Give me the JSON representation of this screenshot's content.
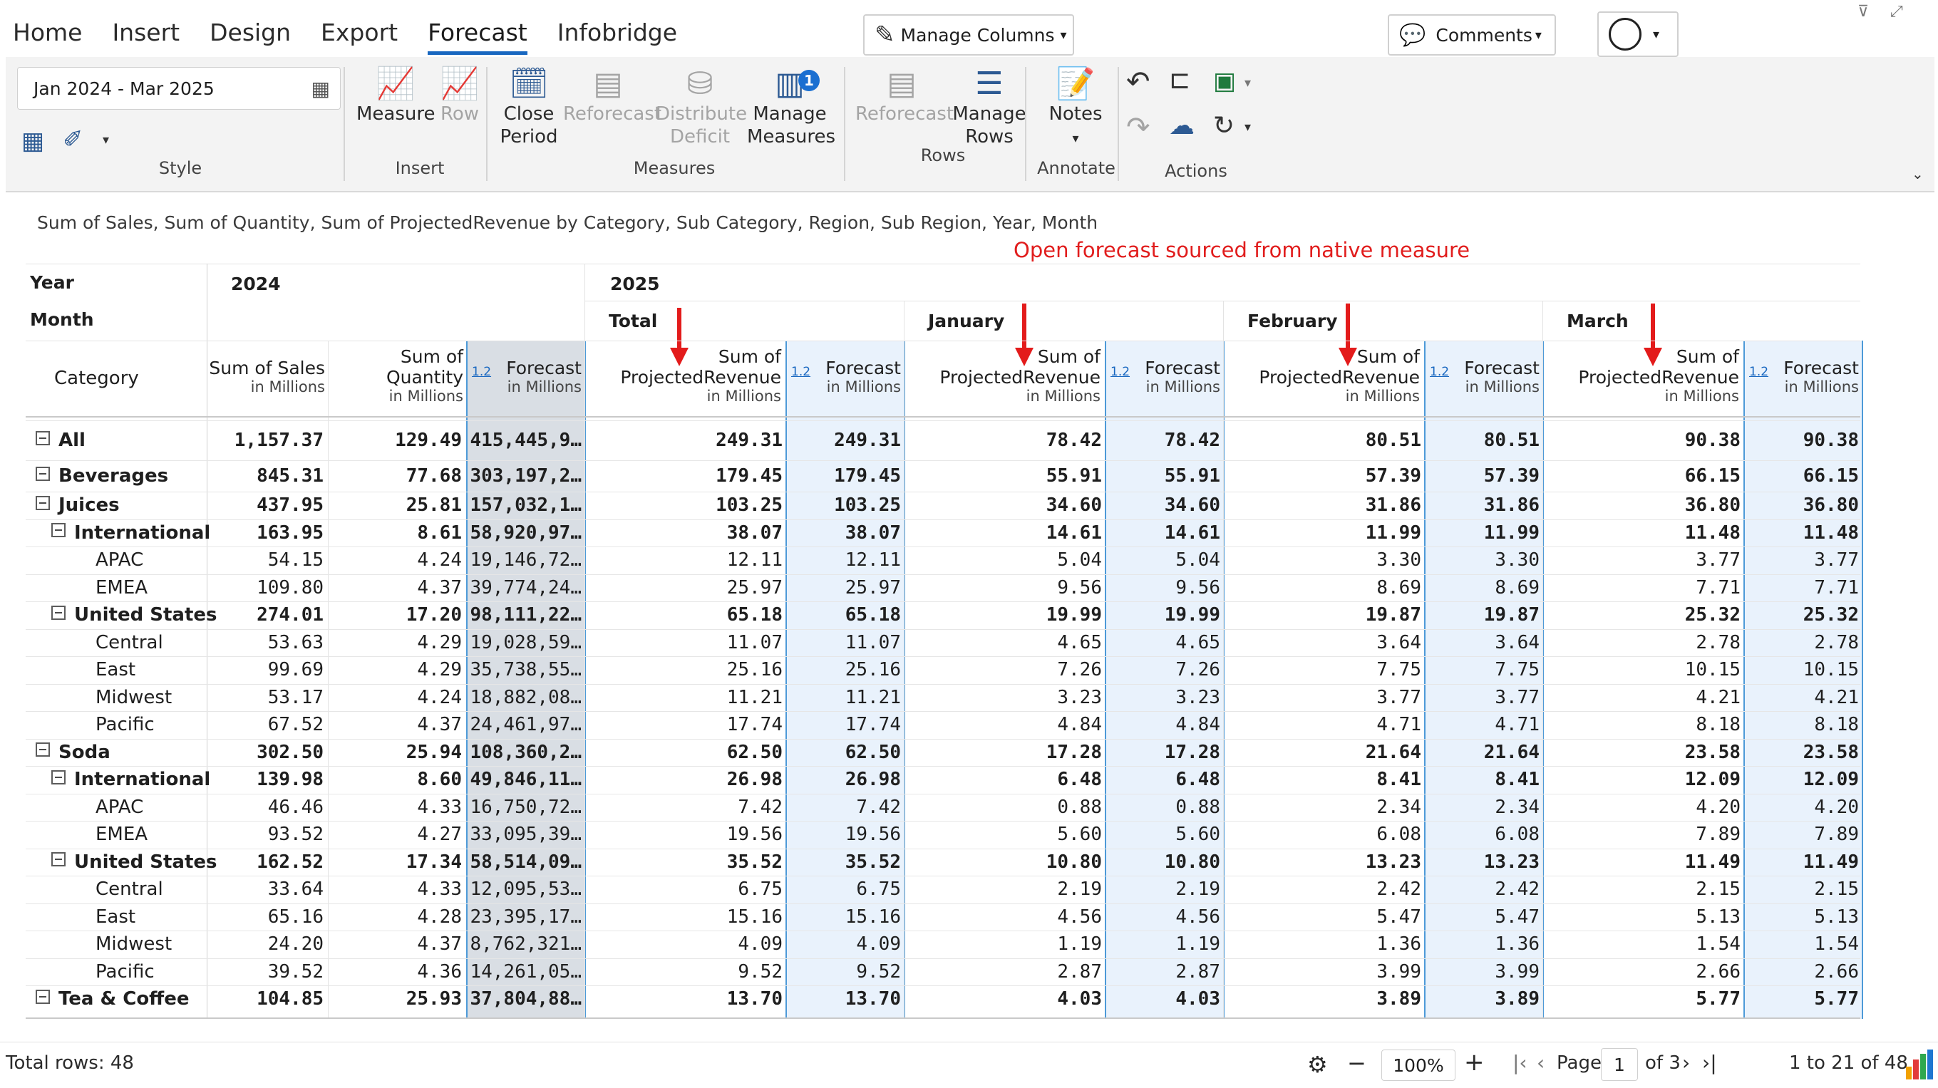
{
  "tabs": [
    {
      "label": "Home",
      "active": false
    },
    {
      "label": "Insert",
      "active": false
    },
    {
      "label": "Design",
      "active": false
    },
    {
      "label": "Export",
      "active": false
    },
    {
      "label": "Forecast",
      "active": true
    },
    {
      "label": "Infobridge",
      "active": false
    }
  ],
  "manage_columns": "Manage Columns",
  "comments": "Comments",
  "date_range": "Jan 2024 - Mar 2025",
  "ribbon": {
    "style_group": "Style",
    "insert_group": "Insert",
    "measure": "Measure",
    "row": "Row",
    "close_period_1": "Close",
    "close_period_2": "Period",
    "reforecast": "Reforecast",
    "distribute_1": "Distribute",
    "distribute_2": "Deficit",
    "manage_measures_1": "Manage",
    "manage_measures_2": "Measures",
    "manage_measures_badge": "1",
    "measures_group": "Measures",
    "reforecast_rows": "Reforecast",
    "manage_rows_1": "Manage",
    "manage_rows_2": "Rows",
    "rows_group": "Rows",
    "notes": "Notes",
    "annotate_group": "Annotate",
    "actions_group": "Actions"
  },
  "caption": "Sum of Sales, Sum of Quantity, Sum of ProjectedRevenue by Category, Sub Category, Region, Sub Region, Year, Month",
  "annotation": "Open forecast sourced from native measure",
  "headers": {
    "year": "Year",
    "month": "Month",
    "category": "Category",
    "y2024": "2024",
    "y2025": "2025",
    "total": "Total",
    "january": "January",
    "february": "February",
    "march": "March",
    "sum_sales": "Sum of Sales",
    "sum_of": "Sum of",
    "quantity": "Quantity",
    "projected": "ProjectedRevenue",
    "forecast": "Forecast",
    "in_millions": "in Millions",
    "tag": "1.2"
  },
  "rows": [
    {
      "label": "All",
      "level": 0,
      "bold": true,
      "toggle": true,
      "v": [
        "1,157.37",
        "129.49",
        "415,445,9…",
        "249.31",
        "249.31",
        "78.42",
        "78.42",
        "80.51",
        "80.51",
        "90.38",
        "90.38"
      ]
    },
    {
      "label": "Beverages",
      "level": 0,
      "bold": true,
      "toggle": true,
      "v": [
        "845.31",
        "77.68",
        "303,197,2…",
        "179.45",
        "179.45",
        "55.91",
        "55.91",
        "57.39",
        "57.39",
        "66.15",
        "66.15"
      ]
    },
    {
      "label": "Juices",
      "level": 1,
      "bold": true,
      "toggle": true,
      "v": [
        "437.95",
        "25.81",
        "157,032,1…",
        "103.25",
        "103.25",
        "34.60",
        "34.60",
        "31.86",
        "31.86",
        "36.80",
        "36.80"
      ]
    },
    {
      "label": "International",
      "level": 2,
      "bold": true,
      "toggle": true,
      "v": [
        "163.95",
        "8.61",
        "58,920,97…",
        "38.07",
        "38.07",
        "14.61",
        "14.61",
        "11.99",
        "11.99",
        "11.48",
        "11.48"
      ]
    },
    {
      "label": "APAC",
      "level": 3,
      "bold": false,
      "toggle": false,
      "v": [
        "54.15",
        "4.24",
        "19,146,72…",
        "12.11",
        "12.11",
        "5.04",
        "5.04",
        "3.30",
        "3.30",
        "3.77",
        "3.77"
      ]
    },
    {
      "label": "EMEA",
      "level": 3,
      "bold": false,
      "toggle": false,
      "v": [
        "109.80",
        "4.37",
        "39,774,24…",
        "25.97",
        "25.97",
        "9.56",
        "9.56",
        "8.69",
        "8.69",
        "7.71",
        "7.71"
      ]
    },
    {
      "label": "United States",
      "level": 2,
      "bold": true,
      "toggle": true,
      "v": [
        "274.01",
        "17.20",
        "98,111,22…",
        "65.18",
        "65.18",
        "19.99",
        "19.99",
        "19.87",
        "19.87",
        "25.32",
        "25.32"
      ]
    },
    {
      "label": "Central",
      "level": 3,
      "bold": false,
      "toggle": false,
      "v": [
        "53.63",
        "4.29",
        "19,028,59…",
        "11.07",
        "11.07",
        "4.65",
        "4.65",
        "3.64",
        "3.64",
        "2.78",
        "2.78"
      ]
    },
    {
      "label": "East",
      "level": 3,
      "bold": false,
      "toggle": false,
      "v": [
        "99.69",
        "4.29",
        "35,738,55…",
        "25.16",
        "25.16",
        "7.26",
        "7.26",
        "7.75",
        "7.75",
        "10.15",
        "10.15"
      ]
    },
    {
      "label": "Midwest",
      "level": 3,
      "bold": false,
      "toggle": false,
      "v": [
        "53.17",
        "4.24",
        "18,882,08…",
        "11.21",
        "11.21",
        "3.23",
        "3.23",
        "3.77",
        "3.77",
        "4.21",
        "4.21"
      ]
    },
    {
      "label": "Pacific",
      "level": 3,
      "bold": false,
      "toggle": false,
      "v": [
        "67.52",
        "4.37",
        "24,461,97…",
        "17.74",
        "17.74",
        "4.84",
        "4.84",
        "4.71",
        "4.71",
        "8.18",
        "8.18"
      ]
    },
    {
      "label": "Soda",
      "level": 1,
      "bold": true,
      "toggle": true,
      "v": [
        "302.50",
        "25.94",
        "108,360,2…",
        "62.50",
        "62.50",
        "17.28",
        "17.28",
        "21.64",
        "21.64",
        "23.58",
        "23.58"
      ]
    },
    {
      "label": "International",
      "level": 2,
      "bold": true,
      "toggle": true,
      "v": [
        "139.98",
        "8.60",
        "49,846,11…",
        "26.98",
        "26.98",
        "6.48",
        "6.48",
        "8.41",
        "8.41",
        "12.09",
        "12.09"
      ]
    },
    {
      "label": "APAC",
      "level": 3,
      "bold": false,
      "toggle": false,
      "v": [
        "46.46",
        "4.33",
        "16,750,72…",
        "7.42",
        "7.42",
        "0.88",
        "0.88",
        "2.34",
        "2.34",
        "4.20",
        "4.20"
      ]
    },
    {
      "label": "EMEA",
      "level": 3,
      "bold": false,
      "toggle": false,
      "v": [
        "93.52",
        "4.27",
        "33,095,39…",
        "19.56",
        "19.56",
        "5.60",
        "5.60",
        "6.08",
        "6.08",
        "7.89",
        "7.89"
      ]
    },
    {
      "label": "United States",
      "level": 2,
      "bold": true,
      "toggle": true,
      "v": [
        "162.52",
        "17.34",
        "58,514,09…",
        "35.52",
        "35.52",
        "10.80",
        "10.80",
        "13.23",
        "13.23",
        "11.49",
        "11.49"
      ]
    },
    {
      "label": "Central",
      "level": 3,
      "bold": false,
      "toggle": false,
      "v": [
        "33.64",
        "4.33",
        "12,095,53…",
        "6.75",
        "6.75",
        "2.19",
        "2.19",
        "2.42",
        "2.42",
        "2.15",
        "2.15"
      ]
    },
    {
      "label": "East",
      "level": 3,
      "bold": false,
      "toggle": false,
      "v": [
        "65.16",
        "4.28",
        "23,395,17…",
        "15.16",
        "15.16",
        "4.56",
        "4.56",
        "5.47",
        "5.47",
        "5.13",
        "5.13"
      ]
    },
    {
      "label": "Midwest",
      "level": 3,
      "bold": false,
      "toggle": false,
      "v": [
        "24.20",
        "4.37",
        "8,762,321…",
        "4.09",
        "4.09",
        "1.19",
        "1.19",
        "1.36",
        "1.36",
        "1.54",
        "1.54"
      ]
    },
    {
      "label": "Pacific",
      "level": 3,
      "bold": false,
      "toggle": false,
      "v": [
        "39.52",
        "4.36",
        "14,261,05…",
        "9.52",
        "9.52",
        "2.87",
        "2.87",
        "3.99",
        "3.99",
        "2.66",
        "2.66"
      ]
    },
    {
      "label": "Tea & Coffee",
      "level": 1,
      "bold": true,
      "toggle": true,
      "v": [
        "104.85",
        "25.93",
        "37,804,88…",
        "13.70",
        "13.70",
        "4.03",
        "4.03",
        "3.89",
        "3.89",
        "5.77",
        "5.77"
      ]
    }
  ],
  "footer": {
    "total_rows": "Total rows: 48",
    "zoom": "100%",
    "page_label": "Page",
    "page_value": "1",
    "of_pages": "of 3",
    "range": "1 to 21 of 48"
  }
}
